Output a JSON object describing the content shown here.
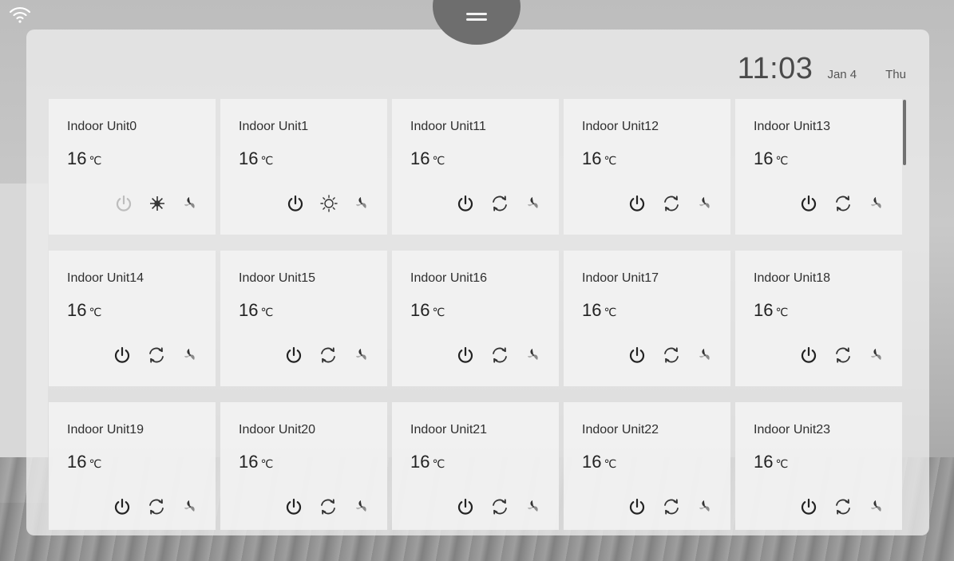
{
  "clock": {
    "time": "11:03",
    "date": "Jan 4",
    "day": "Thu"
  },
  "units": [
    {
      "name": "Indoor Unit0",
      "temp": "16",
      "unit": "℃",
      "power_state": "off",
      "mode_icon": "snowflake-icon",
      "fan_icon": "fan-icon"
    },
    {
      "name": "Indoor Unit1",
      "temp": "16",
      "unit": "℃",
      "power_state": "on",
      "mode_icon": "sun-icon",
      "fan_icon": "fan-icon"
    },
    {
      "name": "Indoor Unit11",
      "temp": "16",
      "unit": "℃",
      "power_state": "on",
      "mode_icon": "cycle-icon",
      "fan_icon": "fan-icon"
    },
    {
      "name": "Indoor Unit12",
      "temp": "16",
      "unit": "℃",
      "power_state": "on",
      "mode_icon": "cycle-icon",
      "fan_icon": "fan-icon"
    },
    {
      "name": "Indoor Unit13",
      "temp": "16",
      "unit": "℃",
      "power_state": "on",
      "mode_icon": "cycle-icon",
      "fan_icon": "fan-icon"
    },
    {
      "name": "Indoor Unit14",
      "temp": "16",
      "unit": "℃",
      "power_state": "on",
      "mode_icon": "cycle-icon",
      "fan_icon": "fan-icon"
    },
    {
      "name": "Indoor Unit15",
      "temp": "16",
      "unit": "℃",
      "power_state": "on",
      "mode_icon": "cycle-icon",
      "fan_icon": "fan-icon"
    },
    {
      "name": "Indoor Unit16",
      "temp": "16",
      "unit": "℃",
      "power_state": "on",
      "mode_icon": "cycle-icon",
      "fan_icon": "fan-icon"
    },
    {
      "name": "Indoor Unit17",
      "temp": "16",
      "unit": "℃",
      "power_state": "on",
      "mode_icon": "cycle-icon",
      "fan_icon": "fan-icon"
    },
    {
      "name": "Indoor Unit18",
      "temp": "16",
      "unit": "℃",
      "power_state": "on",
      "mode_icon": "cycle-icon",
      "fan_icon": "fan-icon"
    },
    {
      "name": "Indoor Unit19",
      "temp": "16",
      "unit": "℃",
      "power_state": "on",
      "mode_icon": "cycle-icon",
      "fan_icon": "fan-icon"
    },
    {
      "name": "Indoor Unit20",
      "temp": "16",
      "unit": "℃",
      "power_state": "on",
      "mode_icon": "cycle-icon",
      "fan_icon": "fan-icon"
    },
    {
      "name": "Indoor Unit21",
      "temp": "16",
      "unit": "℃",
      "power_state": "on",
      "mode_icon": "cycle-icon",
      "fan_icon": "fan-icon"
    },
    {
      "name": "Indoor Unit22",
      "temp": "16",
      "unit": "℃",
      "power_state": "on",
      "mode_icon": "cycle-icon",
      "fan_icon": "fan-icon"
    },
    {
      "name": "Indoor Unit23",
      "temp": "16",
      "unit": "℃",
      "power_state": "on",
      "mode_icon": "cycle-icon",
      "fan_icon": "fan-icon"
    }
  ],
  "colors": {
    "panel": "#ececec",
    "card": "#f3f3f3",
    "icon_active": "#222222",
    "icon_inactive": "#bdbdbd",
    "menu_tab": "#6e6e6e"
  }
}
